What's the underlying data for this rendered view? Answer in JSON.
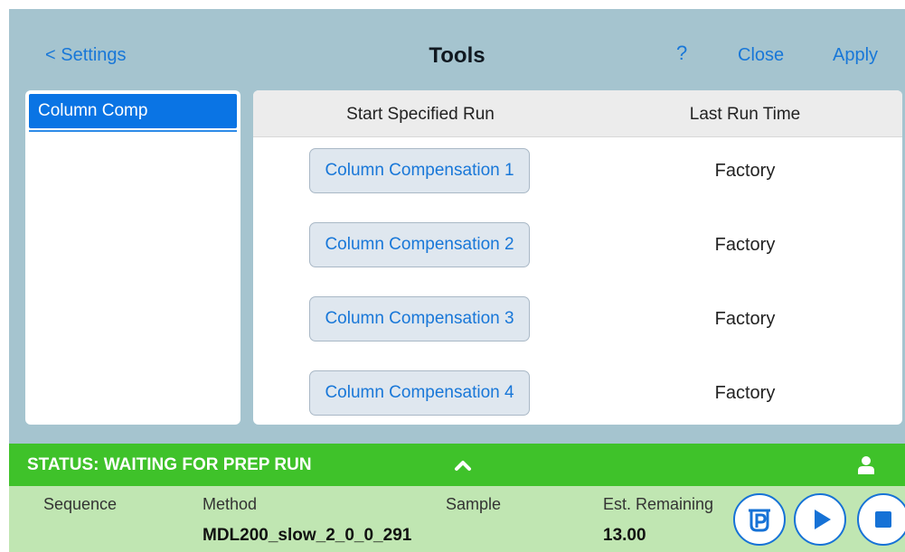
{
  "header": {
    "back_label": "< Settings",
    "title": "Tools",
    "help_label": "?",
    "close_label": "Close",
    "apply_label": "Apply"
  },
  "sidebar": {
    "items": [
      {
        "label": "Column Comp",
        "selected": true
      }
    ]
  },
  "table": {
    "columns": [
      "Start Specified Run",
      "Last Run Time"
    ],
    "rows": [
      {
        "run": "Column Compensation 1",
        "last_run": "Factory"
      },
      {
        "run": "Column Compensation 2",
        "last_run": "Factory"
      },
      {
        "run": "Column Compensation 3",
        "last_run": "Factory"
      },
      {
        "run": "Column Compensation 4",
        "last_run": "Factory"
      }
    ]
  },
  "status": {
    "text": "STATUS: WAITING FOR PREP RUN",
    "expand_icon": "chevron-up-icon",
    "user_icon": "user-icon"
  },
  "bottom": {
    "sequence_label": "Sequence",
    "method_label": "Method",
    "method_value": "MDL200_slow_2_0_0_291",
    "sample_label": "Sample",
    "est_label": "Est. Remaining",
    "est_value": "13.00",
    "buttons": [
      "prep-icon",
      "play-icon",
      "stop-icon"
    ]
  },
  "colors": {
    "background": "#a5c4cf",
    "accent": "#1877d8",
    "selected": "#0a74e4",
    "status_bar": "#3fc22a",
    "bottom_panel": "#c0e6b2"
  }
}
